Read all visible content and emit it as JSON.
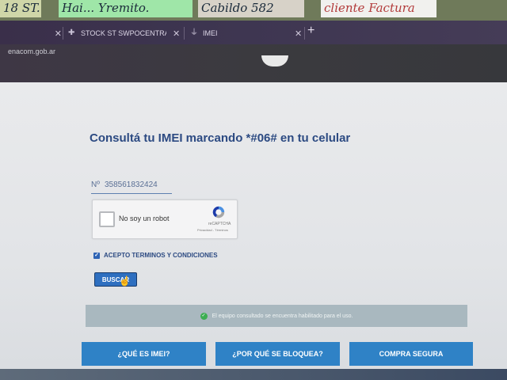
{
  "sticky_notes": [
    "18 ST.",
    "Hai... Yremito.",
    "Cabildo 582",
    "cliente Factura"
  ],
  "browser": {
    "tabs": [
      {
        "label": ""
      },
      {
        "label": "STOCK ST SWPOCENTRAL - Hoj"
      },
      {
        "label": "IMEI"
      }
    ],
    "new_tab_symbol": "+",
    "url": "enacom.gob.ar"
  },
  "page": {
    "title": "Consultá tu IMEI marcando *#06# en tu celular",
    "imei_prefix": "Nº",
    "imei_value": "358561832424",
    "recaptcha": {
      "label": "No soy un robot",
      "brand": "reCAPTCHA",
      "links": "Privacidad - Términos"
    },
    "terms_label": "ACEPTO TERMINOS Y CONDICIONES",
    "terms_checked": true,
    "search_button": "BUSCAR",
    "status_message": "El equipo consultado se encuentra habilitado para el uso.",
    "status_color": "#3cae52",
    "nav_buttons": [
      "¿QUÉ ES IMEI?",
      "¿POR QUÉ SE BLOQUEA?",
      "COMPRA SEGURA"
    ],
    "accent_color": "#2c4a82",
    "button_color": "#2f82c6"
  }
}
